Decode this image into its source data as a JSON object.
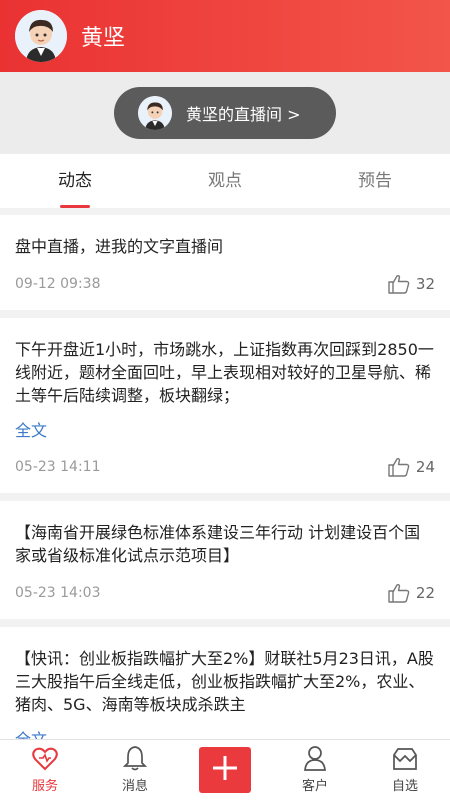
{
  "header": {
    "title": "黄坚",
    "avatar_icon": "avatar-icon"
  },
  "live_button": {
    "label": "黄坚的直播间 >"
  },
  "tabs": [
    {
      "label": "动态",
      "active": true
    },
    {
      "label": "观点",
      "active": false
    },
    {
      "label": "预告",
      "active": false
    }
  ],
  "posts": [
    {
      "text": "盘中直播，进我的文字直播间",
      "more": "",
      "time": "09-12 09:38",
      "likes": "32"
    },
    {
      "text": "下午开盘近1小时，市场跳水，上证指数再次回踩到2850一线附近，题材全面回吐，早上表现相对较好的卫星导航、稀土等午后陆续调整，板块翻绿；",
      "more": "全文",
      "time": "05-23 14:11",
      "likes": "24"
    },
    {
      "text": "【海南省开展绿色标准体系建设三年行动 计划建设百个国家或省级标准化试点示范项目】",
      "more": "",
      "time": "05-23 14:03",
      "likes": "22"
    },
    {
      "text": "【快讯：创业板指跌幅扩大至2%】财联社5月23日讯，A股三大股指午后全线走低，创业板指跌幅扩大至2%，农业、猪肉、5G、海南等板块成杀跌主",
      "more": "全文",
      "time": "",
      "likes": ""
    }
  ],
  "tabbar": [
    {
      "label": "服务",
      "icon": "heart-icon",
      "active": true
    },
    {
      "label": "消息",
      "icon": "bell-icon",
      "active": false
    },
    {
      "label": "",
      "icon": "plus-icon",
      "active": false
    },
    {
      "label": "客户",
      "icon": "person-icon",
      "active": false
    },
    {
      "label": "自选",
      "icon": "box-icon",
      "active": false
    }
  ],
  "colors": {
    "accent": "#e8383d",
    "link": "#3a79c8"
  }
}
